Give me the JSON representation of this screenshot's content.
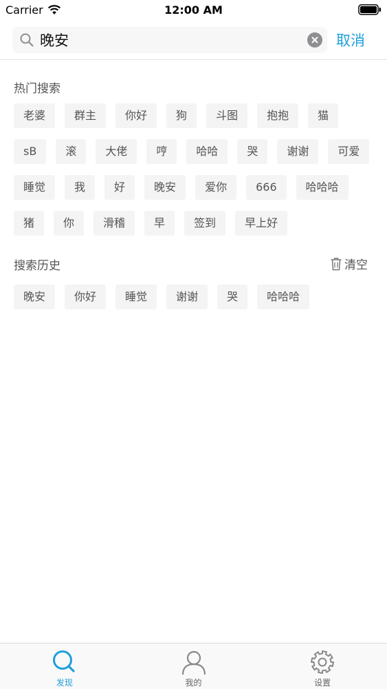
{
  "status_bar": {
    "carrier": "Carrier",
    "time": "12:00 AM"
  },
  "search": {
    "value": "晚安",
    "cancel_label": "取消"
  },
  "hot": {
    "title": "热门搜索",
    "tags": [
      "老婆",
      "群主",
      "你好",
      "狗",
      "斗图",
      "抱抱",
      "猫",
      "sB",
      "滚",
      "大佬",
      "哼",
      "哈哈",
      "哭",
      "谢谢",
      "可爱",
      "睡觉",
      "我",
      "好",
      "晚安",
      "爱你",
      "666",
      "哈哈哈",
      "猪",
      "你",
      "滑稽",
      "早",
      "签到",
      "早上好"
    ]
  },
  "history": {
    "title": "搜索历史",
    "clear_label": "清空",
    "tags": [
      "晚安",
      "你好",
      "睡觉",
      "谢谢",
      "哭",
      "哈哈哈"
    ]
  },
  "tabs": [
    {
      "label": "发现",
      "icon": "search-icon",
      "active": true
    },
    {
      "label": "我的",
      "icon": "person-icon",
      "active": false
    },
    {
      "label": "设置",
      "icon": "gear-icon",
      "active": false
    }
  ],
  "colors": {
    "accent": "#1e9fdc",
    "tag_background": "#f4f4f4",
    "text": "#555555"
  }
}
